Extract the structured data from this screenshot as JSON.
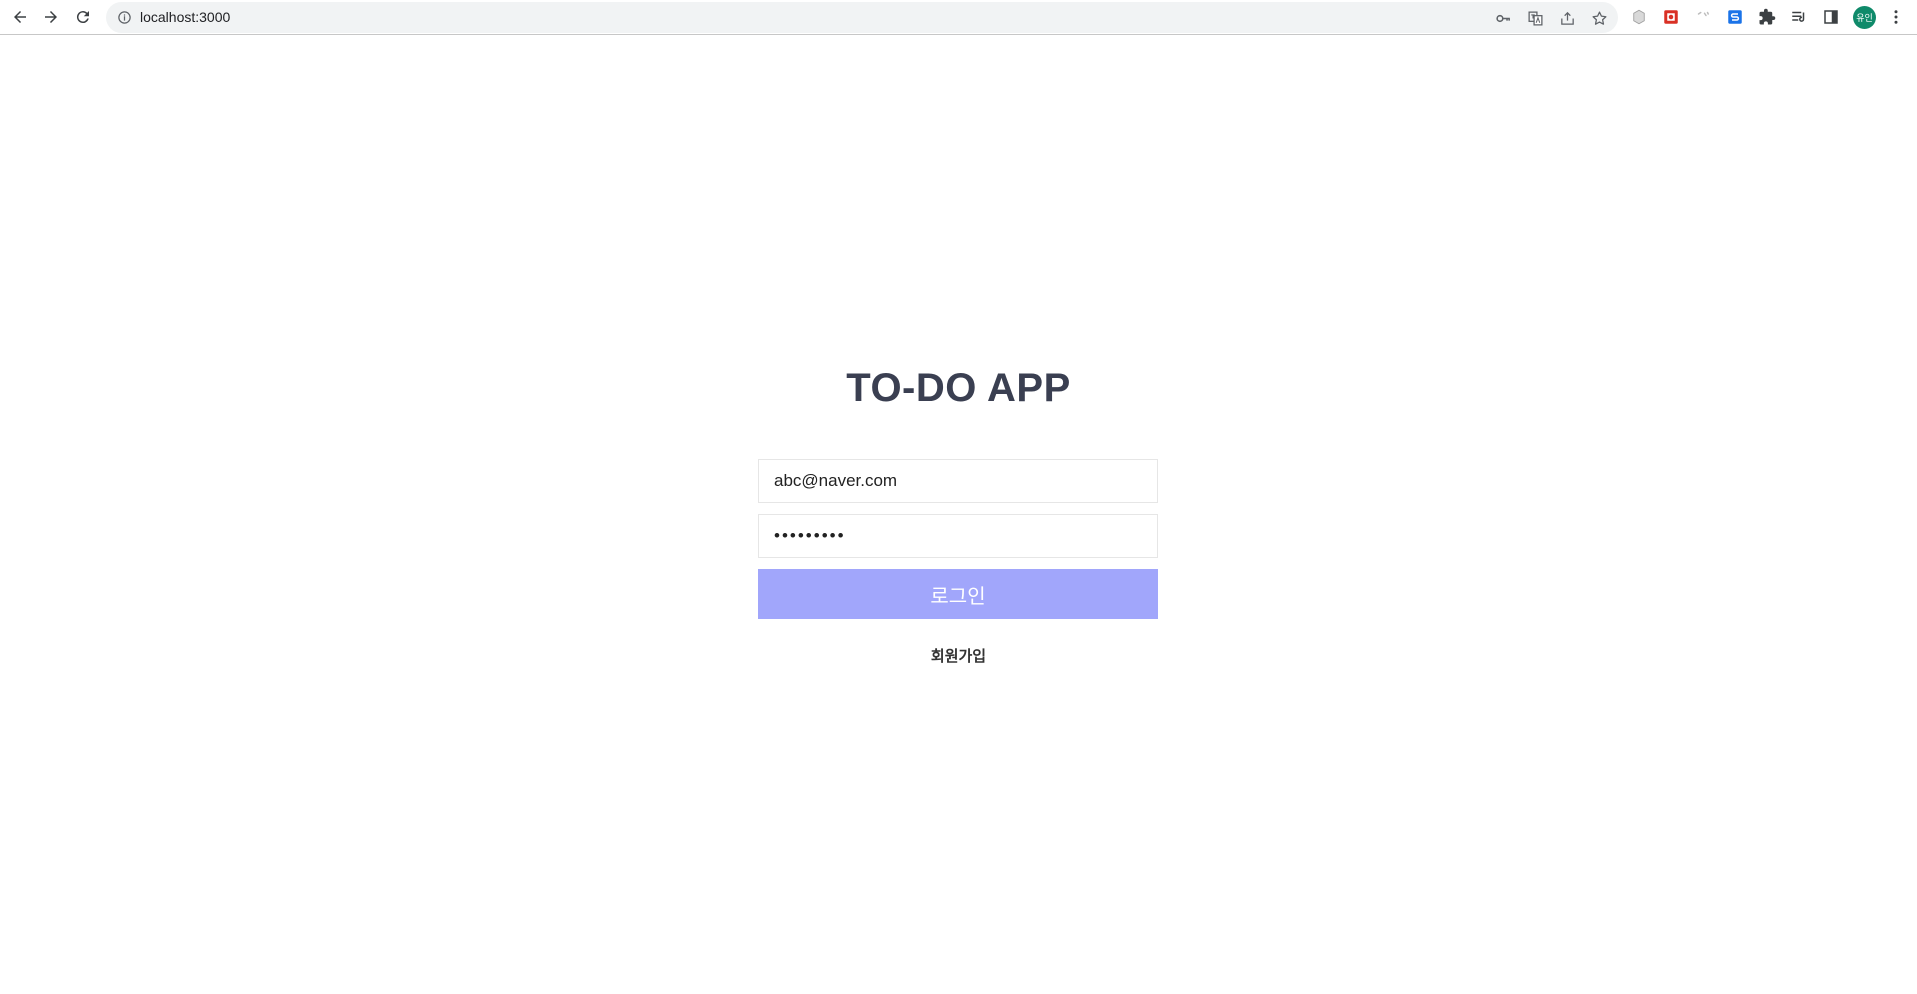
{
  "browser": {
    "url": "localhost:3000",
    "avatar_text": "유인",
    "avatar_color": "#0f8a6a",
    "nav": [
      "back-icon",
      "forward-icon",
      "reload-icon"
    ],
    "omnibox_actions": [
      "key-icon",
      "translate-icon",
      "share-icon",
      "star-icon"
    ],
    "extensions": [
      "extension-grey-icon",
      "extension-red-icon",
      "extension-faded-icon",
      "extension-blue-s-icon",
      "puzzle-icon",
      "reading-list-icon",
      "side-panel-icon"
    ],
    "menu_icon": "more-vert-icon"
  },
  "login": {
    "title": "TO-DO APP",
    "email_value": "abc@naver.com",
    "password_value": "123456789",
    "login_label": "로그인",
    "signup_label": "회원가입",
    "accent_color": "#a1a6fb"
  }
}
